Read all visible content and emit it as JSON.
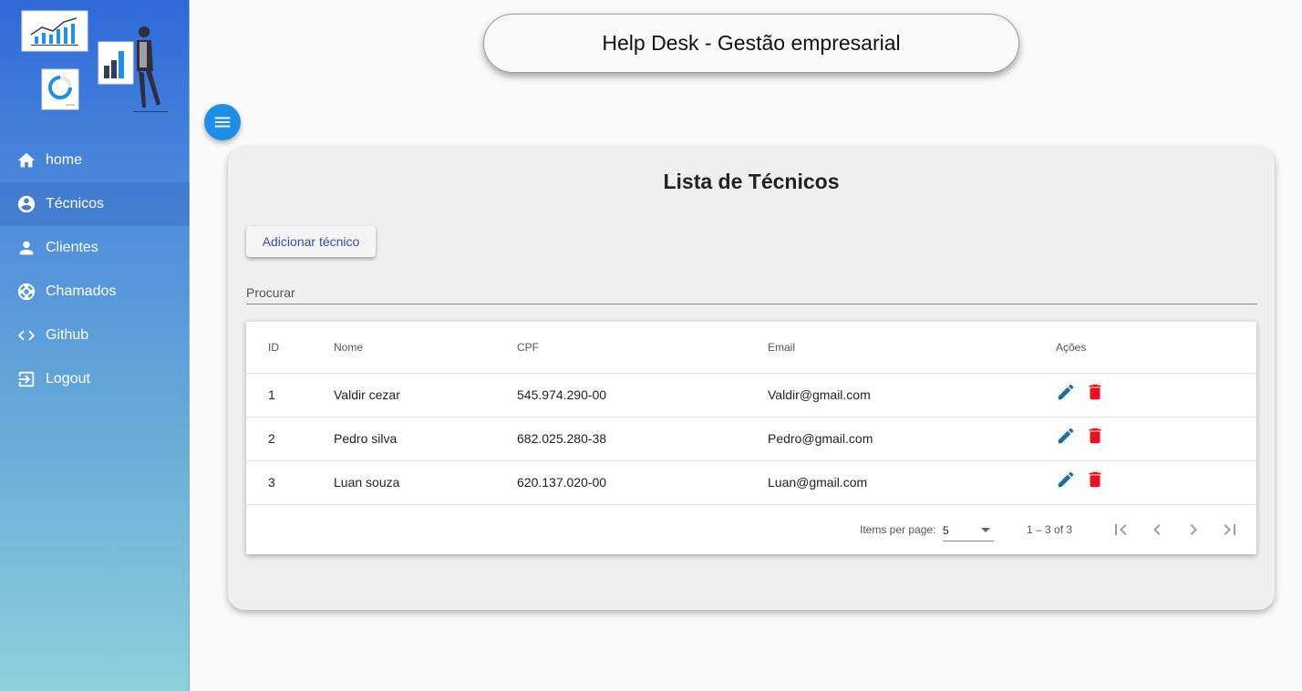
{
  "header": {
    "title": "Help Desk - Gestão empresarial"
  },
  "sidebar": {
    "items": [
      {
        "label": "home",
        "icon": "home-icon"
      },
      {
        "label": "Técnicos",
        "icon": "account-circle-icon",
        "active": true
      },
      {
        "label": "Clientes",
        "icon": "person-icon"
      },
      {
        "label": "Chamados",
        "icon": "support-icon"
      },
      {
        "label": "Github",
        "icon": "code-icon"
      },
      {
        "label": "Logout",
        "icon": "logout-icon"
      }
    ]
  },
  "main": {
    "title": "Lista de Técnicos",
    "add_button": "Adicionar técnico",
    "search_placeholder": "Procurar",
    "table": {
      "columns": [
        "ID",
        "Nome",
        "CPF",
        "Email",
        "Ações"
      ],
      "rows": [
        {
          "id": "1",
          "nome": "Valdir cezar",
          "cpf": "545.974.290-00",
          "email": "Valdir@gmail.com"
        },
        {
          "id": "2",
          "nome": "Pedro silva",
          "cpf": "682.025.280-38",
          "email": "Pedro@gmail.com"
        },
        {
          "id": "3",
          "nome": "Luan souza",
          "cpf": "620.137.020-00",
          "email": "Luan@gmail.com"
        }
      ]
    },
    "paginator": {
      "items_per_page_label": "Items per page:",
      "page_size": "5",
      "range": "1 – 3 of 3"
    }
  },
  "colors": {
    "accent": "#1e8fe6",
    "edit_icon": "#1b6f9e",
    "delete_icon": "#e8121c",
    "button_text": "#3b4aa8"
  }
}
